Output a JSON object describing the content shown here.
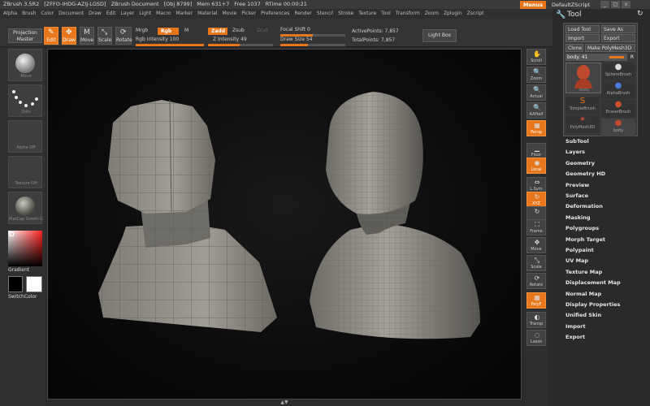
{
  "titlebar": {
    "items": [
      "ZBrush 3.5R2",
      "[ZFFO-IHDG-AZIJ-LGSD]",
      "ZBrush Document",
      "[Obj 8799]",
      "Mem 631+7",
      "Free 1037",
      "RTime 00:00:21"
    ],
    "menus_label": "Menus",
    "script_label": "DefaultZScript",
    "window_controls": [
      "_",
      "□",
      "x"
    ]
  },
  "menu_bar": [
    "Alpha",
    "Brush",
    "Color",
    "Document",
    "Draw",
    "Edit",
    "Layer",
    "Light",
    "Macro",
    "Marker",
    "Material",
    "Movie",
    "Picker",
    "Preferences",
    "Render",
    "Stencil",
    "Stroke",
    "Texture",
    "Tool",
    "Transform",
    "Zoom",
    "Zplugin",
    "Zscript"
  ],
  "toolbar": {
    "projection_master": "Projection Master",
    "edit": "Edit",
    "draw": "Draw",
    "move": "Move",
    "scale": "Scale",
    "rotate": "Rotate",
    "mrgb": "Mrgb",
    "rgb": "Rgb",
    "m": "M",
    "rgb_intensity_label": "Rgb Intensity",
    "rgb_intensity_value": "100",
    "zadd": "Zadd",
    "zsub": "Zsub",
    "zcut": "Zcut",
    "z_intensity_label": "Z Intensity",
    "z_intensity_value": "49",
    "focal_shift_label": "Focal Shift",
    "focal_shift_value": "0",
    "draw_size_label": "Draw Size",
    "draw_size_value": "54",
    "active_points_label": "ActivePoints:",
    "active_points_value": "7,857",
    "total_points_label": "TotalPoints:",
    "total_points_value": "7,857",
    "light_box": "Light Box",
    "rgb_intensity_fraction": 1.0,
    "z_intensity_fraction": 0.49,
    "focal_shift_fraction": 0.5,
    "draw_size_fraction": 0.42
  },
  "left_shelf": {
    "brush_caption": "Move",
    "stroke_caption": "Dots",
    "alpha_caption": "Alpha Off",
    "texture_caption": "Texture Off",
    "material_caption": "MatCap Green-G",
    "gradient_label": "Gradient",
    "switch_color_label": "SwitchColor"
  },
  "right_shelf": [
    {
      "label": "Scroll",
      "icon": "hand-icon",
      "glyph": "✋",
      "active": false
    },
    {
      "label": "Zoom",
      "icon": "magnifier-icon",
      "glyph": "🔍",
      "active": false
    },
    {
      "label": "Actual",
      "icon": "magnifier-icon",
      "glyph": "🔍",
      "active": false
    },
    {
      "label": "AAHalf",
      "icon": "magnifier-icon",
      "glyph": "🔍",
      "active": false
    },
    {
      "label": "Persp",
      "icon": "perspective-icon",
      "glyph": "▦",
      "active": true
    },
    {
      "label": "Floor",
      "icon": "floor-icon",
      "glyph": "▁",
      "active": false
    },
    {
      "label": "Local",
      "icon": "local-icon",
      "glyph": "◉",
      "active": true
    },
    {
      "label": "L.Sym",
      "icon": "symmetry-icon",
      "glyph": "⇔",
      "active": false
    },
    {
      "label": "XYZ",
      "icon": "xyz-icon",
      "glyph": "↻",
      "active": true
    },
    {
      "label": "",
      "icon": "rotate-y-icon",
      "glyph": "↻",
      "active": false
    },
    {
      "label": "Frame",
      "icon": "frame-icon",
      "glyph": "⛶",
      "active": false
    },
    {
      "label": "Move",
      "icon": "move-icon",
      "glyph": "✥",
      "active": false
    },
    {
      "label": "Scale",
      "icon": "scale-icon",
      "glyph": "⤡",
      "active": false
    },
    {
      "label": "Rotate",
      "icon": "rotate-icon",
      "glyph": "⟳",
      "active": false
    },
    {
      "label": "PolyF",
      "icon": "polyframe-icon",
      "glyph": "▦",
      "active": true
    },
    {
      "label": "Transp",
      "icon": "transparency-icon",
      "glyph": "◐",
      "active": false
    },
    {
      "label": "Lasso",
      "icon": "lasso-icon",
      "glyph": "◌",
      "active": false
    }
  ],
  "tool_panel": {
    "title": "Tool",
    "load_tool": "Load Tool",
    "save_as": "Save As",
    "import": "Import",
    "export": "Export",
    "clone": "Clone",
    "make_polymesh": "Make PolyMesh3D",
    "body_label": "body. 41",
    "r_label": "R",
    "tools": [
      {
        "caption": "body"
      },
      {
        "caption": "SphereBrush"
      },
      {
        "caption": "AlphaBrush"
      },
      {
        "caption": "SimpleBrush"
      },
      {
        "caption": "EraserBrush"
      },
      {
        "caption": "PolyMesh3D"
      },
      {
        "caption": "body"
      }
    ],
    "sections": [
      "SubTool",
      "Layers",
      "Geometry",
      "Geometry HD",
      "Preview",
      "Surface",
      "Deformation",
      "Masking",
      "Polygroups",
      "Morph Target",
      "Polypaint",
      "UV Map",
      "Texture Map",
      "Displacement Map",
      "Normal Map",
      "Display Properties",
      "Unified Skin",
      "Import",
      "Export"
    ]
  },
  "colors": {
    "accent": "#e8771c",
    "mesh": "#8e8c84",
    "panel": "#2a2a2a"
  }
}
